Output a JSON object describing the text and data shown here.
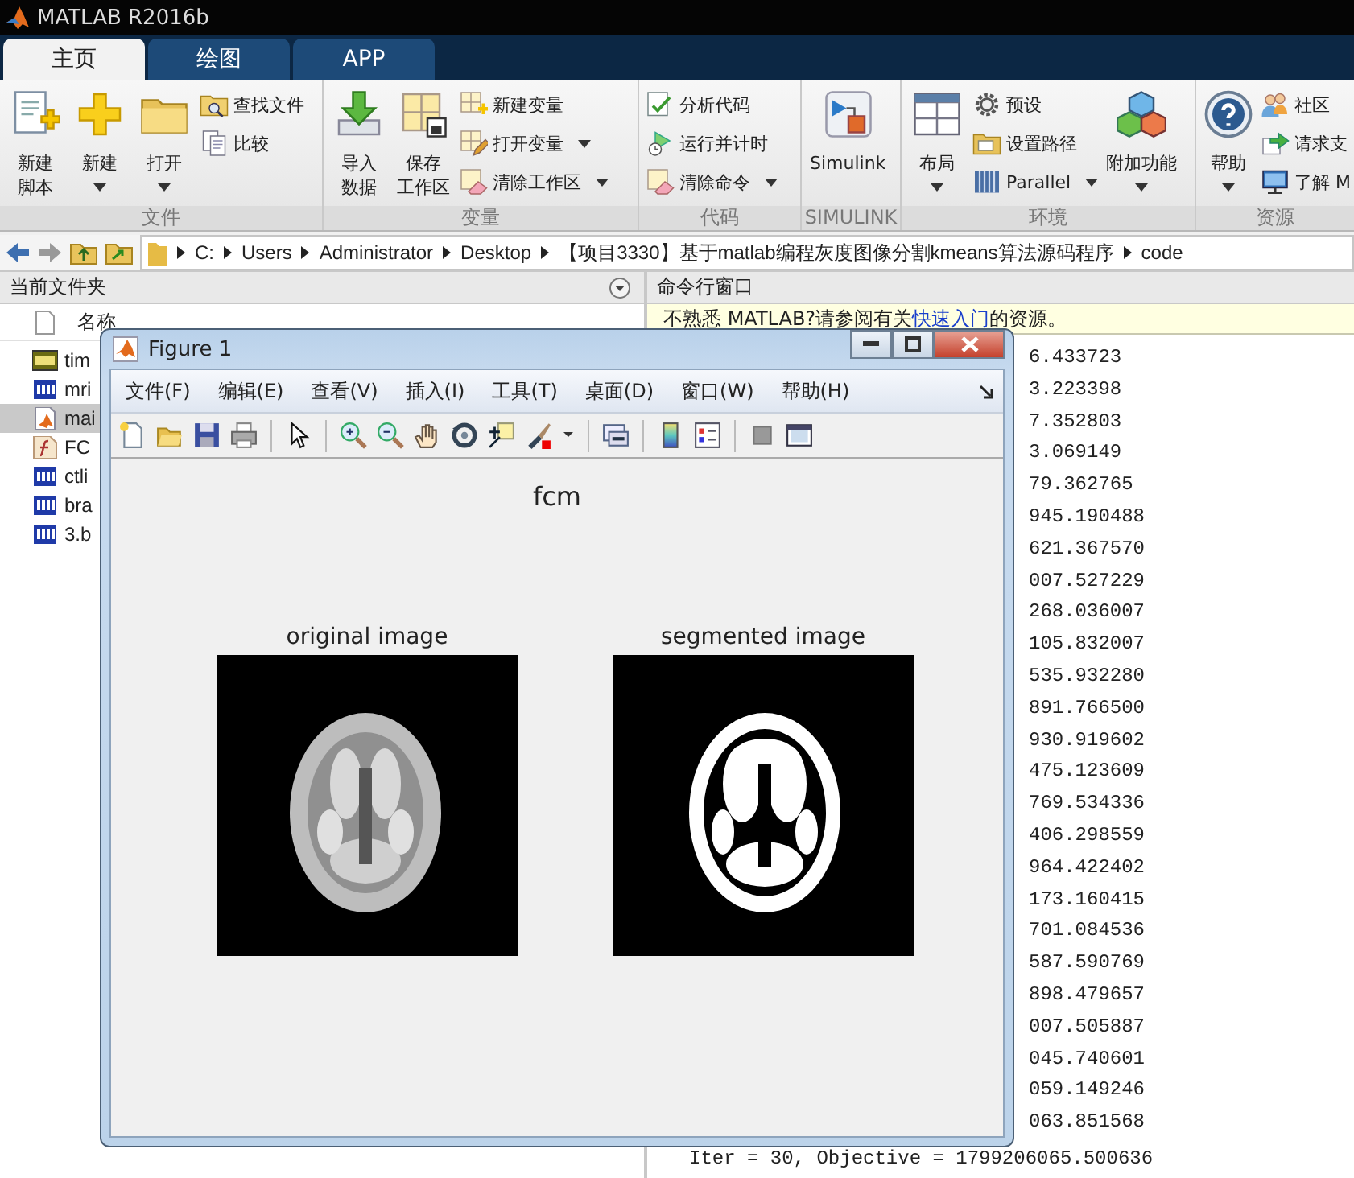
{
  "window": {
    "title": "MATLAB R2016b"
  },
  "tabs": [
    {
      "label": "主页",
      "selected": true
    },
    {
      "label": "绘图",
      "selected": false
    },
    {
      "label": "APP",
      "selected": false
    }
  ],
  "ribbon_groups": [
    {
      "label": "文件",
      "items": [
        {
          "kind": "large",
          "lines": [
            "新建",
            "脚本"
          ],
          "dropdown": false
        },
        {
          "kind": "large",
          "lines": [
            "新建"
          ],
          "dropdown": true
        },
        {
          "kind": "large",
          "lines": [
            "打开"
          ],
          "dropdown": true
        },
        {
          "kind": "small",
          "lines": [
            "查找文件"
          ],
          "dropdown": false
        },
        {
          "kind": "small",
          "lines": [
            "比较"
          ],
          "dropdown": false
        }
      ]
    },
    {
      "label": "变量",
      "items": [
        {
          "kind": "large",
          "lines": [
            "导入",
            "数据"
          ],
          "dropdown": false
        },
        {
          "kind": "large",
          "lines": [
            "保存",
            "工作区"
          ],
          "dropdown": false
        },
        {
          "kind": "small",
          "lines": [
            "新建变量"
          ],
          "dropdown": false
        },
        {
          "kind": "small",
          "lines": [
            "打开变量"
          ],
          "dropdown": true
        },
        {
          "kind": "small",
          "lines": [
            "清除工作区"
          ],
          "dropdown": true
        }
      ]
    },
    {
      "label": "代码",
      "items": [
        {
          "kind": "small",
          "lines": [
            "分析代码"
          ],
          "dropdown": false
        },
        {
          "kind": "small",
          "lines": [
            "运行并计时"
          ],
          "dropdown": false
        },
        {
          "kind": "small",
          "lines": [
            "清除命令"
          ],
          "dropdown": true
        }
      ]
    },
    {
      "label": "SIMULINK",
      "items": [
        {
          "kind": "large",
          "lines": [
            "Simulink"
          ],
          "dropdown": false
        }
      ]
    },
    {
      "label": "环境",
      "items": [
        {
          "kind": "large",
          "lines": [
            "布局"
          ],
          "dropdown": true
        },
        {
          "kind": "small",
          "lines": [
            "预设"
          ],
          "dropdown": false
        },
        {
          "kind": "small",
          "lines": [
            "设置路径"
          ],
          "dropdown": false
        },
        {
          "kind": "small",
          "lines": [
            "Parallel"
          ],
          "dropdown": true
        },
        {
          "kind": "large",
          "lines": [
            "附加功能"
          ],
          "dropdown": true
        }
      ]
    },
    {
      "label": "资源",
      "items": [
        {
          "kind": "large",
          "lines": [
            "帮助"
          ],
          "dropdown": true
        },
        {
          "kind": "small",
          "lines": [
            "社区"
          ],
          "dropdown": false
        },
        {
          "kind": "small",
          "lines": [
            "请求支"
          ],
          "dropdown": false
        },
        {
          "kind": "small",
          "lines": [
            "了解 M"
          ],
          "dropdown": false
        }
      ]
    }
  ],
  "address_bar": {
    "segments": [
      "C:",
      "Users",
      "Administrator",
      "Desktop",
      "【项目3330】基于matlab编程灰度图像分割kmeans算法源码程序",
      "code"
    ]
  },
  "current_folder": {
    "title": "当前文件夹",
    "column": "名称",
    "files": [
      {
        "name": "tim",
        "kind": "jpg",
        "selected": false
      },
      {
        "name": "mri",
        "kind": "bmp",
        "selected": false
      },
      {
        "name": "mai",
        "kind": "script",
        "selected": true
      },
      {
        "name": "FC",
        "kind": "function",
        "selected": false
      },
      {
        "name": "ctli",
        "kind": "bmp",
        "selected": false
      },
      {
        "name": "bra",
        "kind": "bmp",
        "selected": false
      },
      {
        "name": "3.b",
        "kind": "bmp",
        "selected": false
      }
    ]
  },
  "command_window": {
    "title": "命令行窗口",
    "notice": {
      "before": "不熟悉 MATLAB?请参阅有关",
      "link": "快速入门",
      "after": "的资源。"
    },
    "lines": [
      {
        "kind": "tail",
        "text": "6.433723"
      },
      {
        "kind": "tail",
        "text": "3.223398"
      },
      {
        "kind": "tail",
        "text": "7.352803"
      },
      {
        "kind": "tail",
        "text": "3.069149"
      },
      {
        "kind": "tail",
        "text": "79.362765"
      },
      {
        "kind": "tail",
        "text": "945.190488"
      },
      {
        "kind": "tail",
        "text": "621.367570"
      },
      {
        "kind": "tail",
        "text": "007.527229"
      },
      {
        "kind": "tail",
        "text": "268.036007"
      },
      {
        "kind": "tail",
        "text": "105.832007"
      },
      {
        "kind": "tail",
        "text": "535.932280"
      },
      {
        "kind": "tail",
        "text": "891.766500"
      },
      {
        "kind": "tail",
        "text": "930.919602"
      },
      {
        "kind": "tail",
        "text": "475.123609"
      },
      {
        "kind": "tail",
        "text": "769.534336"
      },
      {
        "kind": "tail",
        "text": "406.298559"
      },
      {
        "kind": "tail",
        "text": "964.422402"
      },
      {
        "kind": "tail",
        "text": "173.160415"
      },
      {
        "kind": "tail",
        "text": "701.084536"
      },
      {
        "kind": "tail",
        "text": "587.590769"
      },
      {
        "kind": "tail",
        "text": "898.479657"
      },
      {
        "kind": "tail",
        "text": "007.505887"
      },
      {
        "kind": "tail",
        "text": "045.740601"
      },
      {
        "kind": "tail",
        "text": "059.149246"
      },
      {
        "kind": "tail",
        "text": "063.851568"
      },
      {
        "kind": "full",
        "text": "Iter = 30, Objective = 1799206065.500636"
      }
    ]
  },
  "figure": {
    "title": "Figure 1",
    "menus": [
      "文件(F)",
      "编辑(E)",
      "查看(V)",
      "插入(I)",
      "工具(T)",
      "桌面(D)",
      "窗口(W)",
      "帮助(H)"
    ],
    "plot_title": "fcm",
    "axes": [
      {
        "title": "original image",
        "kind": "original"
      },
      {
        "title": "segmented image",
        "kind": "segmented"
      }
    ]
  }
}
